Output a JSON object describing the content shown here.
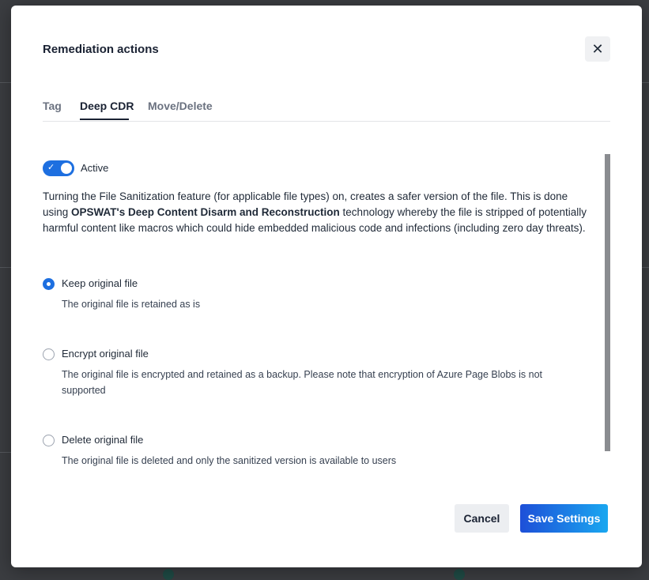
{
  "modal": {
    "title": "Remediation actions",
    "close_icon": "close-icon"
  },
  "tabs": [
    {
      "label": "Tag",
      "active": false
    },
    {
      "label": "Deep CDR",
      "active": true
    },
    {
      "label": "Move/Delete",
      "active": false
    }
  ],
  "toggle": {
    "label": "Active",
    "on": true,
    "color": "#1d6fe0"
  },
  "description": {
    "part1": "Turning the File Sanitization feature (for applicable file types) on, creates a safer version of the file. This is done using ",
    "bold": "OPSWAT's Deep Content Disarm and Reconstruction",
    "part2": " technology whereby the file is stripped of potentially harmful content like macros which could hide embedded malicious code and infections (including zero day threats)."
  },
  "options": [
    {
      "label": "Keep original file",
      "description": "The original file is retained as is",
      "selected": true
    },
    {
      "label": "Encrypt original file",
      "description": "The original file is encrypted and retained as a backup. Please note that encryption of Azure Page Blobs is not supported",
      "selected": false
    },
    {
      "label": "Delete original file",
      "description": "The original file is deleted and only the sanitized version is available to users",
      "selected": false
    }
  ],
  "buttons": {
    "cancel": "Cancel",
    "save": "Save Settings"
  },
  "colors": {
    "accent": "#1d6fe0",
    "save_gradient_start": "#1d4fd8",
    "save_gradient_end": "#1aa7f0"
  }
}
